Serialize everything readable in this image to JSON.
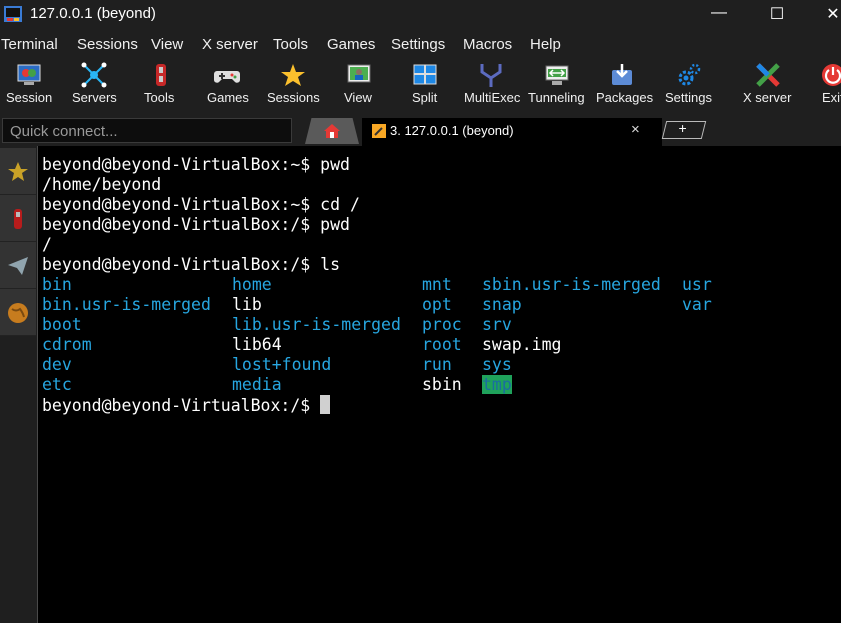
{
  "window": {
    "title": "127.0.0.1 (beyond)"
  },
  "menu": [
    "Terminal",
    "Sessions",
    "View",
    "X server",
    "Tools",
    "Games",
    "Settings",
    "Macros",
    "Help"
  ],
  "toolbar": [
    {
      "label": "Session",
      "icon": "session-icon"
    },
    {
      "label": "Servers",
      "icon": "servers-icon"
    },
    {
      "label": "Tools",
      "icon": "tools-icon"
    },
    {
      "label": "Games",
      "icon": "games-icon"
    },
    {
      "label": "Sessions",
      "icon": "star-icon"
    },
    {
      "label": "View",
      "icon": "view-icon"
    },
    {
      "label": "Split",
      "icon": "split-icon"
    },
    {
      "label": "MultiExec",
      "icon": "multiexec-icon"
    },
    {
      "label": "Tunneling",
      "icon": "tunneling-icon"
    },
    {
      "label": "Packages",
      "icon": "packages-icon"
    },
    {
      "label": "Settings",
      "icon": "settings-icon"
    },
    {
      "label": "X server",
      "icon": "xserver-icon"
    },
    {
      "label": "Exit",
      "icon": "power-icon"
    }
  ],
  "quick_connect": {
    "placeholder": "Quick connect..."
  },
  "tab": {
    "title": "3. 127.0.0.1 (beyond)",
    "close": "×",
    "new": "+"
  },
  "terminal": {
    "lines": [
      "beyond@beyond-VirtualBox:~$ pwd",
      "/home/beyond",
      "beyond@beyond-VirtualBox:~$ cd /",
      "beyond@beyond-VirtualBox:/$ pwd",
      "/",
      "beyond@beyond-VirtualBox:/$ ls"
    ],
    "ls_columns": [
      [
        "bin",
        "bin.usr-is-merged",
        "boot",
        "cdrom",
        "dev",
        "etc"
      ],
      [
        "home",
        "lib",
        "lib.usr-is-merged",
        "lib64",
        "lost+found",
        "media"
      ],
      [
        "mnt",
        "opt",
        "proc",
        "root",
        "run",
        "sbin"
      ],
      [
        "sbin.usr-is-merged",
        "snap",
        "srv",
        "swap.img",
        "sys",
        "tmp"
      ],
      [
        "usr",
        "var"
      ]
    ],
    "prompt": "beyond@beyond-VirtualBox:/$ ",
    "colors": {
      "dir": "#27a6e0",
      "file": "#ffffff",
      "tmp_bg": "#1fa25b",
      "tmp_fg": "#1a6ea0"
    },
    "plain_files": [
      "lib",
      "lib64",
      "swap.img",
      "sbin"
    ]
  }
}
